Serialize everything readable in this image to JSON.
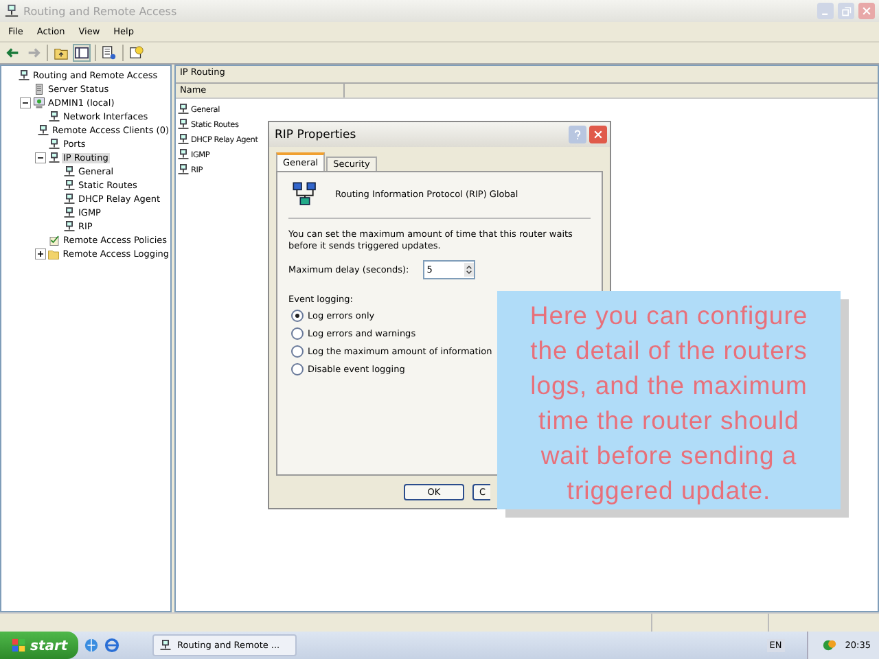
{
  "window": {
    "title": "Routing and Remote Access"
  },
  "menu": [
    "File",
    "Action",
    "View",
    "Help"
  ],
  "tree": [
    {
      "label": "Routing and Remote Access",
      "kind": "server",
      "selected": false,
      "children": [
        {
          "label": "Server Status",
          "kind": "status",
          "selected": false
        },
        {
          "label": "ADMIN1 (local)",
          "kind": "computer",
          "expanded": true,
          "selected": false,
          "children": [
            {
              "label": "Network Interfaces",
              "kind": "node",
              "selected": false
            },
            {
              "label": "Remote Access Clients (0)",
              "kind": "node",
              "selected": false
            },
            {
              "label": "Ports",
              "kind": "node",
              "selected": false
            },
            {
              "label": "IP Routing",
              "kind": "node",
              "expanded": true,
              "selected": true,
              "children": [
                {
                  "label": "General",
                  "kind": "node",
                  "selected": false
                },
                {
                  "label": "Static Routes",
                  "kind": "node",
                  "selected": false
                },
                {
                  "label": "DHCP Relay Agent",
                  "kind": "node",
                  "selected": false
                },
                {
                  "label": "IGMP",
                  "kind": "node",
                  "selected": false
                },
                {
                  "label": "RIP",
                  "kind": "node",
                  "selected": false
                }
              ]
            },
            {
              "label": "Remote Access Policies",
              "kind": "policy",
              "selected": false
            },
            {
              "label": "Remote Access Logging",
              "kind": "folder",
              "expanded": false,
              "selected": false
            }
          ]
        }
      ]
    }
  ],
  "list": {
    "title": "IP Routing",
    "columns": [
      "Name"
    ],
    "rows": [
      "General",
      "Static Routes",
      "DHCP Relay Agent",
      "IGMP",
      "RIP"
    ]
  },
  "dialog": {
    "title": "RIP Properties",
    "tabs": [
      {
        "label": "General",
        "selected": true
      },
      {
        "label": "Security",
        "selected": false
      }
    ],
    "heading": "Routing Information Protocol (RIP) Global",
    "description": "You can set the maximum amount of time that this router waits before it sends triggered updates.",
    "delay_label": "Maximum delay (seconds):",
    "delay_value": "5",
    "logging_label": "Event logging:",
    "options": [
      {
        "label": "Log errors only",
        "selected": true
      },
      {
        "label": "Log errors and warnings",
        "selected": false
      },
      {
        "label": "Log the maximum amount of information",
        "selected": false
      },
      {
        "label": "Disable event logging",
        "selected": false
      }
    ],
    "buttons": [
      "OK",
      "C"
    ]
  },
  "callout": "Here you can configure the detail of the routers logs, and the maximum time the router should wait before sending a triggered update.",
  "taskbar": {
    "start": "start",
    "task": "Routing and Remote ...",
    "language": "EN",
    "clock": "20:35"
  }
}
